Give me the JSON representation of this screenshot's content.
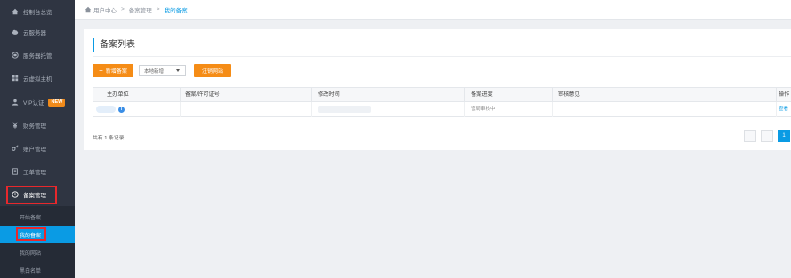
{
  "sidebar": {
    "items": [
      {
        "label": "控制台总览",
        "icon": "dashboard-icon"
      },
      {
        "label": "云服务器",
        "icon": "cloud-icon"
      },
      {
        "label": "服务器托管",
        "icon": "server-icon"
      },
      {
        "label": "云虚拟主机",
        "icon": "grid-icon"
      },
      {
        "label": "VIP认证",
        "icon": "user-icon",
        "badge": "NEW"
      },
      {
        "label": "财务管理",
        "icon": "yen-icon"
      },
      {
        "label": "账户管理",
        "icon": "key-icon"
      },
      {
        "label": "工单管理",
        "icon": "document-icon"
      },
      {
        "label": "备案管理",
        "icon": "clipboard-icon"
      }
    ],
    "submenu": [
      {
        "label": "开始备案"
      },
      {
        "label": "我的备案"
      },
      {
        "label": "我的网站"
      },
      {
        "label": "黑白名单"
      }
    ]
  },
  "breadcrumb": {
    "home": "用户中心",
    "sep": ">",
    "section": "备案管理",
    "current": "我的备案"
  },
  "panel": {
    "title": "备案列表",
    "new_button": "新增备案",
    "filter_value": "本地新增",
    "cancel_button": "注销网站"
  },
  "table": {
    "headers": [
      "主办单位",
      "备案/许可证号",
      "修改时间",
      "备案进度",
      "审核意见",
      "操作"
    ],
    "rows": [
      {
        "unit": "",
        "license": "",
        "modified": "",
        "progress": "管局审核中",
        "opinion": "",
        "action": "查看"
      }
    ]
  },
  "footer": {
    "total": "共有 1 条记录",
    "page": "1"
  },
  "colors": {
    "accent": "#0a9be4",
    "orange": "#f58c16",
    "sidebar_bg": "#2f3542",
    "highlight": "#e8282c"
  }
}
